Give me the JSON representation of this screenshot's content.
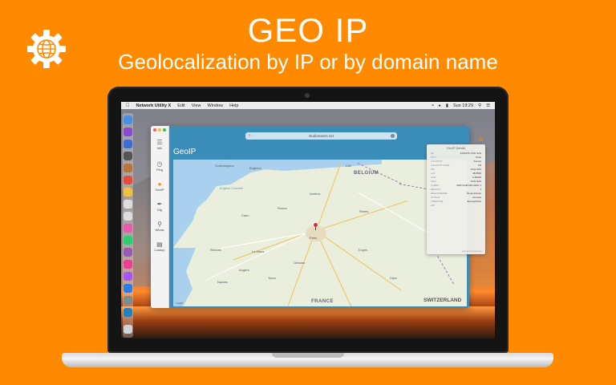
{
  "hero": {
    "title": "GEO IP",
    "subtitle": "Geolocalization by IP or by domain name",
    "logo_icon": "gear-globe-icon"
  },
  "menubar": {
    "app_name": "Network Utility X",
    "menus": [
      "Edit",
      "View",
      "Window",
      "Help"
    ],
    "clock": "Sun 19:29"
  },
  "sidebar": {
    "items": [
      {
        "label": "Info",
        "icon": "list-icon"
      },
      {
        "label": "Ping",
        "icon": "stopwatch-icon"
      },
      {
        "label": "GeoIP",
        "icon": "location-pin-icon",
        "active": true
      },
      {
        "label": "Dig",
        "icon": "shovel-icon"
      },
      {
        "label": "Whois",
        "icon": "magnifier-icon"
      },
      {
        "label": "Lookup",
        "icon": "server-icon"
      }
    ]
  },
  "toolbar": {
    "url": "studiotowns.net"
  },
  "panel": {
    "title": "GeoIP"
  },
  "map": {
    "labels": {
      "belgium": "BELGIUM",
      "france": "FRANCE",
      "switzerland": "SWITZERLAND",
      "paris": "Paris",
      "southampton": "Southampton",
      "brighton": "Brighton",
      "amiens": "Amiens",
      "rouen": "Rouen",
      "caen": "Caen",
      "reims": "Reims",
      "le_mans": "Le Mans",
      "tours": "Tours",
      "orleans": "Orléans",
      "rennes": "Rennes",
      "angers": "Angers",
      "nantes": "Nantes",
      "dijon": "Dijon",
      "troyes": "Troyes",
      "lille": "Lille",
      "english_channel": "English Channel"
    },
    "legal": "Legal"
  },
  "details": {
    "title": "GeoIP Details",
    "rows": [
      {
        "key": "AS",
        "value": "AS16276 OVH SAS"
      },
      {
        "key": "CITY",
        "value": "Paris"
      },
      {
        "key": "COUNTRY",
        "value": "France"
      },
      {
        "key": "COUNTRYCODE",
        "value": "FR"
      },
      {
        "key": "ISP",
        "value": "OVH SAS"
      },
      {
        "key": "LAT",
        "value": "48.8566"
      },
      {
        "key": "LON",
        "value": "2.35222"
      },
      {
        "key": "ORG",
        "value": "OVH SAS"
      },
      {
        "key": "QUERY",
        "value": "2001:41d0:401:3100::1"
      },
      {
        "key": "REGION",
        "value": "J"
      },
      {
        "key": "REGIONNAME",
        "value": "Île-de-France"
      },
      {
        "key": "STATUS",
        "value": "success"
      },
      {
        "key": "TIMEZONE",
        "value": "Europe/Paris"
      },
      {
        "key": "ZIP",
        "value": ""
      }
    ],
    "credit": "powered by ip-api.com"
  },
  "colors": {
    "background": "#ff8a00",
    "app_header": "#3a8db9",
    "accent": "#ff8a00",
    "pin": "#e0262a"
  }
}
